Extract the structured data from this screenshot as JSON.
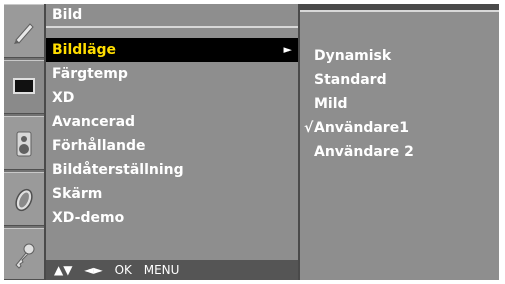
{
  "menu": {
    "title": "Bild",
    "selected_index": 0,
    "items": [
      {
        "label": "Bildläge",
        "has_submenu": true
      },
      {
        "label": "Färgtemp"
      },
      {
        "label": "XD"
      },
      {
        "label": "Avancerad"
      },
      {
        "label": "Förhållande"
      },
      {
        "label": "Bildåterställning"
      },
      {
        "label": "Skärm"
      },
      {
        "label": "XD-demo"
      }
    ],
    "submenu_arrow": "►"
  },
  "submenu": {
    "check_mark": "√",
    "checked_index": 3,
    "items": [
      "Dynamisk",
      "Standard",
      "Mild",
      "Användare1",
      "Användare 2"
    ]
  },
  "footer": {
    "arrows_up_down": "▲▼",
    "arrows_left_right": "◄►",
    "ok": "OK",
    "menu": "MENU"
  },
  "sidebar_icons": [
    "picture-icon",
    "tv-screen-icon",
    "speaker-icon",
    "clock-icon",
    "key-icon"
  ],
  "colors": {
    "selected_text": "#ffdd00",
    "selected_bg": "#000000"
  }
}
